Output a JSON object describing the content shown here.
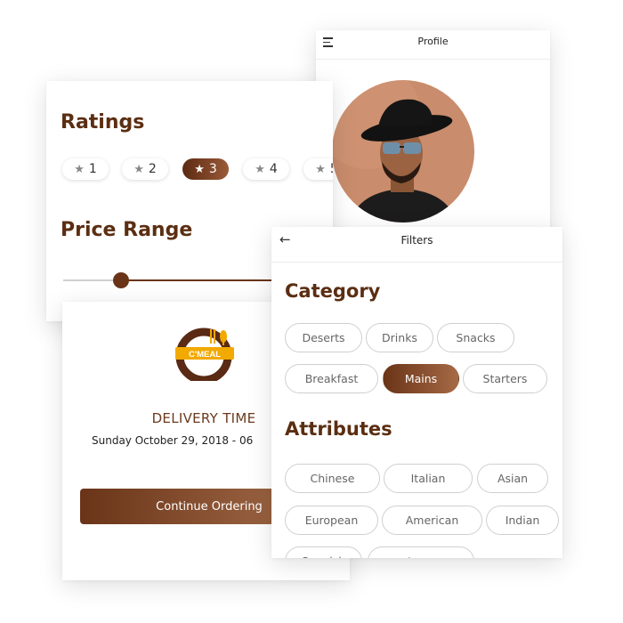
{
  "profile": {
    "title": "Profile"
  },
  "ratings": {
    "title": "Ratings",
    "pills": [
      {
        "label": "1",
        "selected": false
      },
      {
        "label": "2",
        "selected": false
      },
      {
        "label": "3",
        "selected": true
      },
      {
        "label": "4",
        "selected": false
      },
      {
        "label": "5",
        "selected": false
      }
    ],
    "price_title": "Price Range"
  },
  "delivery": {
    "logo_text": "C'MEAL",
    "title": "DELIVERY TIME",
    "date": "Sunday October 29, 2018  -  06",
    "continue_label": "Continue Ordering"
  },
  "filters": {
    "title": "Filters",
    "category_title": "Category",
    "categories": [
      "Deserts",
      "Drinks",
      "Snacks",
      "Breakfast",
      "Mains",
      "Starters"
    ],
    "selected_category": "Mains",
    "attributes_title": "Attributes",
    "attributes": [
      "Chinese",
      "Italian",
      "Asian",
      "European",
      "American",
      "Indian",
      "Spanish",
      "portuguese"
    ]
  },
  "colors": {
    "brand_brown": "#6a3418",
    "brand_light": "#a8714e",
    "heading": "#5b2e12",
    "logo_yellow": "#f2a900"
  }
}
